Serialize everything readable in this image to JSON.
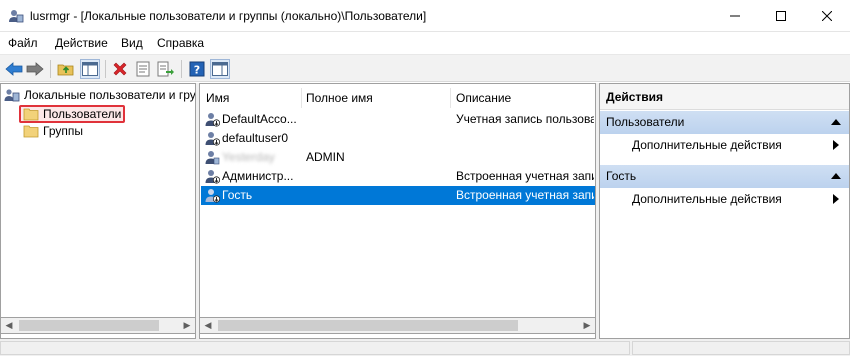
{
  "window": {
    "title": "lusrmgr - [Локальные пользователи и группы (локально)\\Пользователи]",
    "icon": "users-console-icon"
  },
  "menu": [
    "Файл",
    "Действие",
    "Вид",
    "Справка"
  ],
  "toolbar": {
    "buttons": [
      "back-arrow-icon",
      "forward-arrow-icon",
      "up-folder-icon",
      "show-hide-tree-icon",
      "delete-icon",
      "properties-icon",
      "export-list-icon",
      "help-icon",
      "action-pane-icon"
    ]
  },
  "tree": {
    "root": "Локальные пользователи и гру",
    "items": [
      "Пользователи",
      "Группы"
    ],
    "selected": "Пользователи"
  },
  "list": {
    "columns": [
      "Имя",
      "Полное имя",
      "Описание"
    ],
    "rows": [
      {
        "name": "DefaultAcco...",
        "full_name": "",
        "description": "Учетная запись пользова"
      },
      {
        "name": "defaultuser0",
        "full_name": "",
        "description": ""
      },
      {
        "name": "Yesterday",
        "full_name": "ADMIN",
        "description": ""
      },
      {
        "name": "Администр...",
        "full_name": "",
        "description": "Встроенная учетная запи"
      },
      {
        "name": "Гость",
        "full_name": "",
        "description": "Встроенная учетная запи"
      }
    ],
    "selected_row": "Гость"
  },
  "actions": {
    "title": "Действия",
    "groups": [
      {
        "label": "Пользователи",
        "items": [
          "Дополнительные действия"
        ]
      },
      {
        "label": "Гость",
        "items": [
          "Дополнительные действия"
        ]
      }
    ]
  },
  "colors": {
    "selection": "#0078d7",
    "highlight_box": "#e0323a",
    "action_group_bg": "#c6d9f1"
  }
}
